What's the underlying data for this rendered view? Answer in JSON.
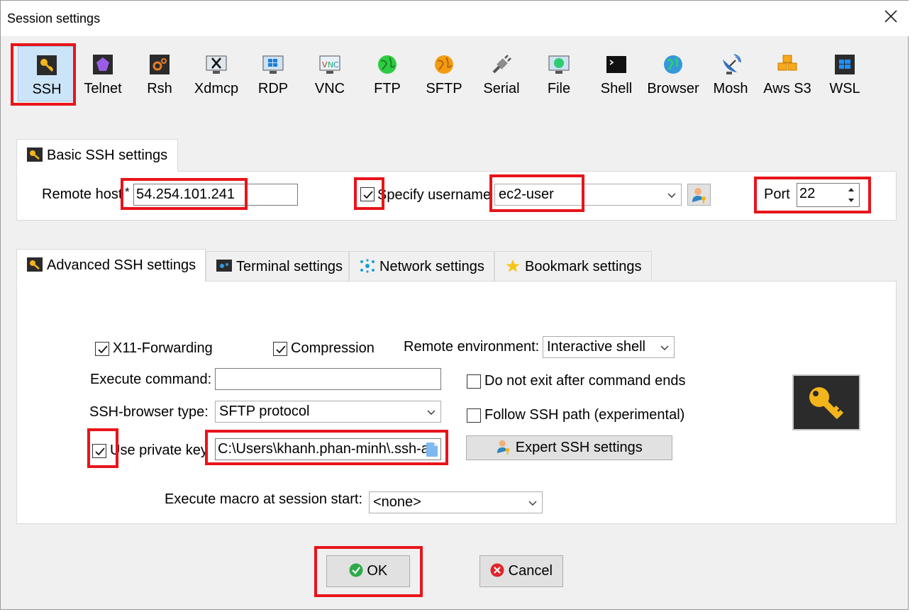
{
  "window": {
    "title": "Session settings"
  },
  "session_types": [
    {
      "label": "SSH",
      "icon": "ssh-key-icon",
      "selected": true
    },
    {
      "label": "Telnet",
      "icon": "telnet-icon"
    },
    {
      "label": "Rsh",
      "icon": "rsh-icon"
    },
    {
      "label": "Xdmcp",
      "icon": "xdmcp-icon"
    },
    {
      "label": "RDP",
      "icon": "rdp-icon"
    },
    {
      "label": "VNC",
      "icon": "vnc-icon"
    },
    {
      "label": "FTP",
      "icon": "ftp-globe-icon"
    },
    {
      "label": "SFTP",
      "icon": "sftp-globe-icon"
    },
    {
      "label": "Serial",
      "icon": "serial-plug-icon"
    },
    {
      "label": "File",
      "icon": "file-monitor-icon"
    },
    {
      "label": "Shell",
      "icon": "shell-terminal-icon"
    },
    {
      "label": "Browser",
      "icon": "browser-globe-icon"
    },
    {
      "label": "Mosh",
      "icon": "mosh-satellite-icon"
    },
    {
      "label": "Aws S3",
      "icon": "aws-s3-cubes-icon"
    },
    {
      "label": "WSL",
      "icon": "wsl-windows-icon"
    }
  ],
  "basic": {
    "tab_label": "Basic SSH settings",
    "remote_host_label": "Remote host",
    "required_mark": "*",
    "remote_host_value": "54.254.101.241",
    "specify_username_label": "Specify username",
    "specify_username_checked": true,
    "username_value": "ec2-user",
    "port_label": "Port",
    "port_value": "22"
  },
  "tabs": [
    {
      "label": "Advanced SSH settings",
      "icon": "ssh-key-icon",
      "active": true
    },
    {
      "label": "Terminal settings",
      "icon": "terminal-icon"
    },
    {
      "label": "Network settings",
      "icon": "network-icon"
    },
    {
      "label": "Bookmark settings",
      "icon": "star-icon"
    }
  ],
  "advanced": {
    "x11_label": "X11-Forwarding",
    "x11_checked": true,
    "compression_label": "Compression",
    "compression_checked": true,
    "remote_env_label": "Remote environment:",
    "remote_env_value": "Interactive shell",
    "execute_command_label": "Execute command:",
    "execute_command_value": "",
    "do_not_exit_label": "Do not exit after command ends",
    "do_not_exit_checked": false,
    "browser_type_label": "SSH-browser type:",
    "browser_type_value": "SFTP protocol",
    "follow_path_label": "Follow SSH path (experimental)",
    "follow_path_checked": false,
    "private_key_label": "Use private key",
    "private_key_checked": true,
    "private_key_value": "C:\\Users\\khanh.phan-minh\\.ssh-a",
    "expert_button_label": "Expert SSH settings",
    "macro_label": "Execute macro at session start:",
    "macro_value": "<none>"
  },
  "buttons": {
    "ok_label": "OK",
    "cancel_label": "Cancel"
  },
  "colors": {
    "highlight_red": "#e8141b",
    "selected_bg": "#cce4f7",
    "ok_green": "#2eaa4a",
    "cancel_red": "#e0262b"
  }
}
